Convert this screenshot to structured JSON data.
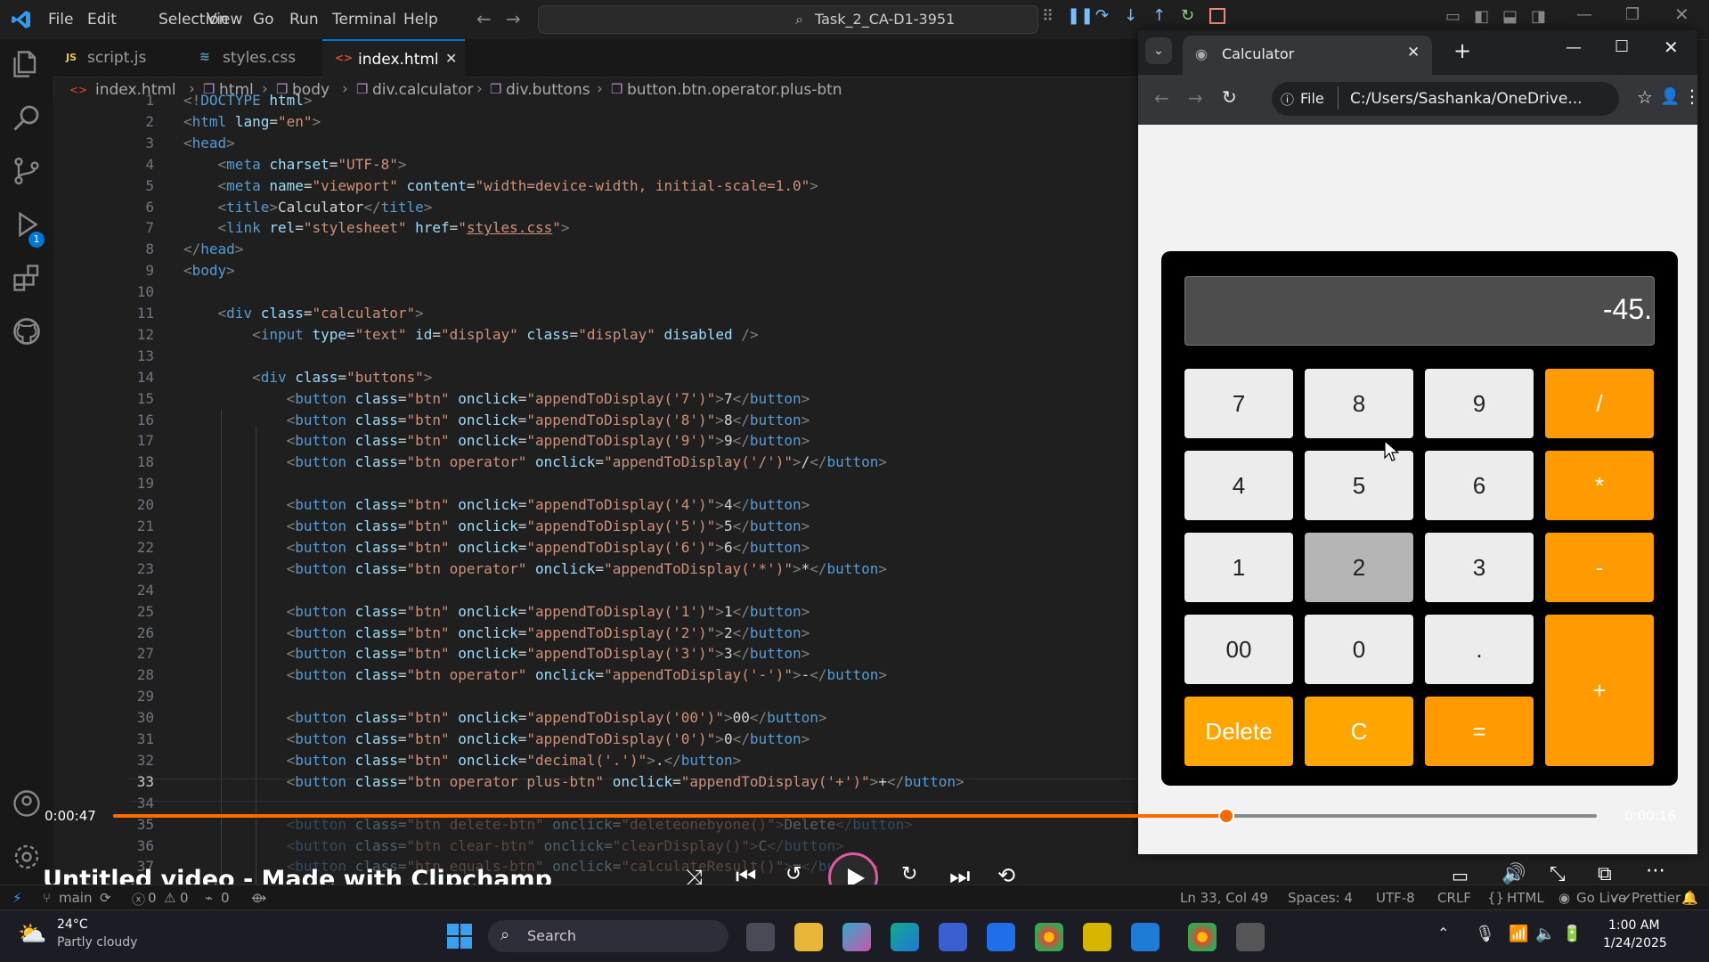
{
  "menu": [
    "File",
    "Edit",
    "Selection",
    "View",
    "Go",
    "Run",
    "Terminal",
    "Help"
  ],
  "command_center": "Task_2_CA-D1-3951",
  "tabs": [
    {
      "label": "script.js",
      "icon": "JS",
      "color": "#e8c84a"
    },
    {
      "label": "styles.css",
      "icon": "≋",
      "color": "#519aba"
    },
    {
      "label": "index.html",
      "icon": "<>",
      "color": "#e44d26",
      "active": true
    }
  ],
  "breadcrumb": [
    "index.html",
    "html",
    "body",
    "div.calculator",
    "div.buttons",
    "button.btn.operator.plus-btn"
  ],
  "activity_badge": "1",
  "current_line": "33",
  "code_lines": [
    {
      "n": "1",
      "html": "<span class='p'>&lt;!</span><span class='t'>DOCTYPE</span> <span class='a'>html</span><span class='p'>&gt;</span>"
    },
    {
      "n": "2",
      "html": "<span class='p'>&lt;</span><span class='t'>html</span> <span class='a'>lang</span>=<span class='s'>\"en\"</span><span class='p'>&gt;</span>"
    },
    {
      "n": "3",
      "html": "<span class='p'>&lt;</span><span class='t'>head</span><span class='p'>&gt;</span>"
    },
    {
      "n": "4",
      "html": "    <span class='p'>&lt;</span><span class='t'>meta</span> <span class='a'>charset</span>=<span class='s'>\"UTF-8\"</span><span class='p'>&gt;</span>"
    },
    {
      "n": "5",
      "html": "    <span class='p'>&lt;</span><span class='t'>meta</span> <span class='a'>name</span>=<span class='s'>\"viewport\"</span> <span class='a'>content</span>=<span class='s'>\"width=device-width, initial-scale=1.0\"</span><span class='p'>&gt;</span>"
    },
    {
      "n": "6",
      "html": "    <span class='p'>&lt;</span><span class='t'>title</span><span class='p'>&gt;</span><span class='tx'>Calculator</span><span class='p'>&lt;/</span><span class='t'>title</span><span class='p'>&gt;</span>"
    },
    {
      "n": "7",
      "html": "    <span class='p'>&lt;</span><span class='t'>link</span> <span class='a'>rel</span>=<span class='s'>\"stylesheet\"</span> <span class='a'>href</span>=<span class='s'>\"<u>styles.css</u>\"</span><span class='p'>&gt;</span>"
    },
    {
      "n": "8",
      "html": "<span class='p'>&lt;/</span><span class='t'>head</span><span class='p'>&gt;</span>"
    },
    {
      "n": "9",
      "html": "<span class='p'>&lt;</span><span class='t'>body</span><span class='p'>&gt;</span>"
    },
    {
      "n": "10",
      "html": ""
    },
    {
      "n": "11",
      "html": "    <span class='p'>&lt;</span><span class='t'>div</span> <span class='a'>class</span>=<span class='s'>\"calculator\"</span><span class='p'>&gt;</span>"
    },
    {
      "n": "12",
      "html": "        <span class='p'>&lt;</span><span class='t'>input</span> <span class='a'>type</span>=<span class='s'>\"text\"</span> <span class='a'>id</span>=<span class='s'>\"display\"</span> <span class='a'>class</span>=<span class='s'>\"display\"</span> <span class='a'>disabled</span> <span class='p'>/&gt;</span>"
    },
    {
      "n": "13",
      "html": ""
    },
    {
      "n": "14",
      "html": "        <span class='p'>&lt;</span><span class='t'>div</span> <span class='a'>class</span>=<span class='s'>\"buttons\"</span><span class='p'>&gt;</span>"
    },
    {
      "n": "15",
      "html": "            <span class='p'>&lt;</span><span class='t'>button</span> <span class='a'>class</span>=<span class='s'>\"btn\"</span> <span class='a'>onclick</span>=<span class='s'>\"appendToDisplay('7')\"</span><span class='p'>&gt;</span><span class='tx'>7</span><span class='p'>&lt;/</span><span class='t'>button</span><span class='p'>&gt;</span>"
    },
    {
      "n": "16",
      "html": "            <span class='p'>&lt;</span><span class='t'>button</span> <span class='a'>class</span>=<span class='s'>\"btn\"</span> <span class='a'>onclick</span>=<span class='s'>\"appendToDisplay('8')\"</span><span class='p'>&gt;</span><span class='tx'>8</span><span class='p'>&lt;/</span><span class='t'>button</span><span class='p'>&gt;</span>"
    },
    {
      "n": "17",
      "html": "            <span class='p'>&lt;</span><span class='t'>button</span> <span class='a'>class</span>=<span class='s'>\"btn\"</span> <span class='a'>onclick</span>=<span class='s'>\"appendToDisplay('9')\"</span><span class='p'>&gt;</span><span class='tx'>9</span><span class='p'>&lt;/</span><span class='t'>button</span><span class='p'>&gt;</span>"
    },
    {
      "n": "18",
      "html": "            <span class='p'>&lt;</span><span class='t'>button</span> <span class='a'>class</span>=<span class='s'>\"btn operator\"</span> <span class='a'>onclick</span>=<span class='s'>\"appendToDisplay('/')\"</span><span class='p'>&gt;</span><span class='tx'>/</span><span class='p'>&lt;/</span><span class='t'>button</span><span class='p'>&gt;</span>"
    },
    {
      "n": "19",
      "html": ""
    },
    {
      "n": "20",
      "html": "            <span class='p'>&lt;</span><span class='t'>button</span> <span class='a'>class</span>=<span class='s'>\"btn\"</span> <span class='a'>onclick</span>=<span class='s'>\"appendToDisplay('4')\"</span><span class='p'>&gt;</span><span class='tx'>4</span><span class='p'>&lt;/</span><span class='t'>button</span><span class='p'>&gt;</span>"
    },
    {
      "n": "21",
      "html": "            <span class='p'>&lt;</span><span class='t'>button</span> <span class='a'>class</span>=<span class='s'>\"btn\"</span> <span class='a'>onclick</span>=<span class='s'>\"appendToDisplay('5')\"</span><span class='p'>&gt;</span><span class='tx'>5</span><span class='p'>&lt;/</span><span class='t'>button</span><span class='p'>&gt;</span>"
    },
    {
      "n": "22",
      "html": "            <span class='p'>&lt;</span><span class='t'>button</span> <span class='a'>class</span>=<span class='s'>\"btn\"</span> <span class='a'>onclick</span>=<span class='s'>\"appendToDisplay('6')\"</span><span class='p'>&gt;</span><span class='tx'>6</span><span class='p'>&lt;/</span><span class='t'>button</span><span class='p'>&gt;</span>"
    },
    {
      "n": "23",
      "html": "            <span class='p'>&lt;</span><span class='t'>button</span> <span class='a'>class</span>=<span class='s'>\"btn operator\"</span> <span class='a'>onclick</span>=<span class='s'>\"appendToDisplay('*')\"</span><span class='p'>&gt;</span><span class='tx'>*</span><span class='p'>&lt;/</span><span class='t'>button</span><span class='p'>&gt;</span>"
    },
    {
      "n": "24",
      "html": ""
    },
    {
      "n": "25",
      "html": "            <span class='p'>&lt;</span><span class='t'>button</span> <span class='a'>class</span>=<span class='s'>\"btn\"</span> <span class='a'>onclick</span>=<span class='s'>\"appendToDisplay('1')\"</span><span class='p'>&gt;</span><span class='tx'>1</span><span class='p'>&lt;/</span><span class='t'>button</span><span class='p'>&gt;</span>"
    },
    {
      "n": "26",
      "html": "            <span class='p'>&lt;</span><span class='t'>button</span> <span class='a'>class</span>=<span class='s'>\"btn\"</span> <span class='a'>onclick</span>=<span class='s'>\"appendToDisplay('2')\"</span><span class='p'>&gt;</span><span class='tx'>2</span><span class='p'>&lt;/</span><span class='t'>button</span><span class='p'>&gt;</span>"
    },
    {
      "n": "27",
      "html": "            <span class='p'>&lt;</span><span class='t'>button</span> <span class='a'>class</span>=<span class='s'>\"btn\"</span> <span class='a'>onclick</span>=<span class='s'>\"appendToDisplay('3')\"</span><span class='p'>&gt;</span><span class='tx'>3</span><span class='p'>&lt;/</span><span class='t'>button</span><span class='p'>&gt;</span>"
    },
    {
      "n": "28",
      "html": "            <span class='p'>&lt;</span><span class='t'>button</span> <span class='a'>class</span>=<span class='s'>\"btn operator\"</span> <span class='a'>onclick</span>=<span class='s'>\"appendToDisplay('-')\"</span><span class='p'>&gt;</span><span class='tx'>-</span><span class='p'>&lt;/</span><span class='t'>button</span><span class='p'>&gt;</span>"
    },
    {
      "n": "29",
      "html": ""
    },
    {
      "n": "30",
      "html": "            <span class='p'>&lt;</span><span class='t'>button</span> <span class='a'>class</span>=<span class='s'>\"btn\"</span> <span class='a'>onclick</span>=<span class='s'>\"appendToDisplay('00')\"</span><span class='p'>&gt;</span><span class='tx'>00</span><span class='p'>&lt;/</span><span class='t'>button</span><span class='p'>&gt;</span>"
    },
    {
      "n": "31",
      "html": "            <span class='p'>&lt;</span><span class='t'>button</span> <span class='a'>class</span>=<span class='s'>\"btn\"</span> <span class='a'>onclick</span>=<span class='s'>\"appendToDisplay('0')\"</span><span class='p'>&gt;</span><span class='tx'>0</span><span class='p'>&lt;/</span><span class='t'>button</span><span class='p'>&gt;</span>"
    },
    {
      "n": "32",
      "html": "            <span class='p'>&lt;</span><span class='t'>button</span> <span class='a'>class</span>=<span class='s'>\"btn\"</span> <span class='a'>onclick</span>=<span class='s'>\"decimal('.')\"</span><span class='p'>&gt;</span><span class='tx'>.</span><span class='p'>&lt;/</span><span class='t'>button</span><span class='p'>&gt;</span>"
    },
    {
      "n": "33",
      "html": "            <span class='p'>&lt;</span><span class='t'>button</span> <span class='a'>class</span>=<span class='s'>\"btn operator plus-btn\"</span> <span class='a'>onclick</span>=<span class='s'>\"appendToDisplay('+')\"</span><span class='p'>&gt;</span><span class='tx'>+</span><span class='p'>&lt;/</span><span class='t'>button</span><span class='p'>&gt;</span>"
    },
    {
      "n": "34",
      "html": ""
    },
    {
      "n": "35",
      "html": "            <span class='p'>&lt;</span><span class='t'>button</span> <span class='a'>class</span>=<span class='s'>\"btn delete-btn\"</span> <span class='a'>onclick</span>=<span class='s'>\"deleteonebyone()\"</span><span class='p'>&gt;</span><span class='tx'>Delete</span><span class='p'>&lt;/</span><span class='t'>button</span><span class='p'>&gt;</span>"
    },
    {
      "n": "36",
      "html": "            <span class='p'>&lt;</span><span class='t'>button</span> <span class='a'>class</span>=<span class='s'>\"btn clear-btn\"</span> <span class='a'>onclick</span>=<span class='s'>\"clearDisplay()\"</span><span class='p'>&gt;</span><span class='tx'>C</span><span class='p'>&lt;/</span><span class='t'>button</span><span class='p'>&gt;</span>"
    },
    {
      "n": "37",
      "html": "            <span class='p'>&lt;</span><span class='t'>button</span> <span class='a'>class</span>=<span class='s'>\"btn equals-btn\"</span> <span class='a'>onclick</span>=<span class='s'>\"calculateResult()\"</span><span class='p'>&gt;</span><span class='tx'>=</span><span class='p'>&lt;/</span><span class='t'>button</span><span class='p'>&gt;</span>"
    }
  ],
  "browser": {
    "tab_title": "Calculator",
    "file_chip": "File",
    "url": "C:/Users/Sashanka/OneDrive..."
  },
  "calculator": {
    "display": "-45.",
    "buttons": [
      {
        "label": "7",
        "kind": "num"
      },
      {
        "label": "8",
        "kind": "num"
      },
      {
        "label": "9",
        "kind": "num"
      },
      {
        "label": "/",
        "kind": "op"
      },
      {
        "label": "4",
        "kind": "num"
      },
      {
        "label": "5",
        "kind": "num"
      },
      {
        "label": "6",
        "kind": "num"
      },
      {
        "label": "*",
        "kind": "op"
      },
      {
        "label": "1",
        "kind": "num"
      },
      {
        "label": "2",
        "kind": "num",
        "hover": true
      },
      {
        "label": "3",
        "kind": "num"
      },
      {
        "label": "-",
        "kind": "op"
      },
      {
        "label": "00",
        "kind": "num"
      },
      {
        "label": "0",
        "kind": "num"
      },
      {
        "label": ".",
        "kind": "num"
      },
      {
        "label": "+",
        "kind": "op"
      },
      {
        "label": "Delete",
        "kind": "clr"
      },
      {
        "label": "C",
        "kind": "clr"
      },
      {
        "label": "=",
        "kind": "op"
      }
    ]
  },
  "video": {
    "title": "Untitled video - Made with Clipchamp",
    "elapsed": "0:00:47",
    "remaining": "0:00:16",
    "progress": 0.75
  },
  "status": {
    "branch": "main",
    "errors": "0",
    "warnings": "0",
    "ports": "0",
    "position": "Ln 33, Col 49",
    "spaces": "Spaces: 4",
    "encoding": "UTF-8",
    "eol": "CRLF",
    "language": "HTML",
    "golive": "Go Live",
    "prettier": "Prettier"
  },
  "taskbar": {
    "weather_temp": "24°C",
    "weather_desc": "Partly cloudy",
    "search": "Search",
    "time": "1:00 AM",
    "date": "1/24/2025"
  },
  "colors": {
    "accent": "#0078d4",
    "orange": "#ff9a00",
    "progress": "#ff6a00"
  }
}
